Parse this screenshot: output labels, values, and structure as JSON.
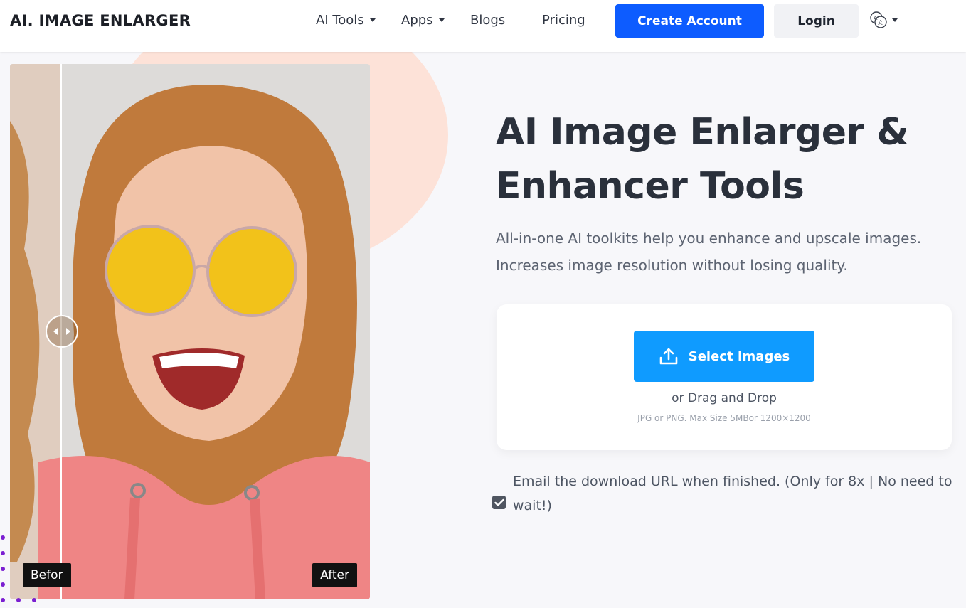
{
  "header": {
    "logo": "AI. IMAGE ENLARGER",
    "nav": [
      {
        "label": "AI Tools",
        "has_dropdown": true
      },
      {
        "label": "Apps",
        "has_dropdown": true
      },
      {
        "label": "Blogs",
        "has_dropdown": false
      },
      {
        "label": "Pricing",
        "has_dropdown": false
      }
    ],
    "create_account": "Create Account",
    "login": "Login",
    "language_icon": "translate-icon"
  },
  "hero": {
    "title": "AI Image Enlarger & Enhancer Tools",
    "subtitle_line1": "All-in-one AI toolkits help you enhance and upscale images.",
    "subtitle_line2": "Increases image resolution without losing quality.",
    "before_label": "Befor",
    "after_label": "After"
  },
  "upload": {
    "select_label": "Select Images",
    "drag_text": "or Drag and Drop",
    "hint": "JPG or PNG. Max Size 5MBor 1200×1200"
  },
  "email_option": {
    "line1": "Email the download URL when finished. (Only for 8x | No need to",
    "line2": "wait!)",
    "checked": true
  },
  "colors": {
    "primary": "#0d5cff",
    "select_button": "#0f9bff",
    "accent_blob": "#fde2d8"
  }
}
